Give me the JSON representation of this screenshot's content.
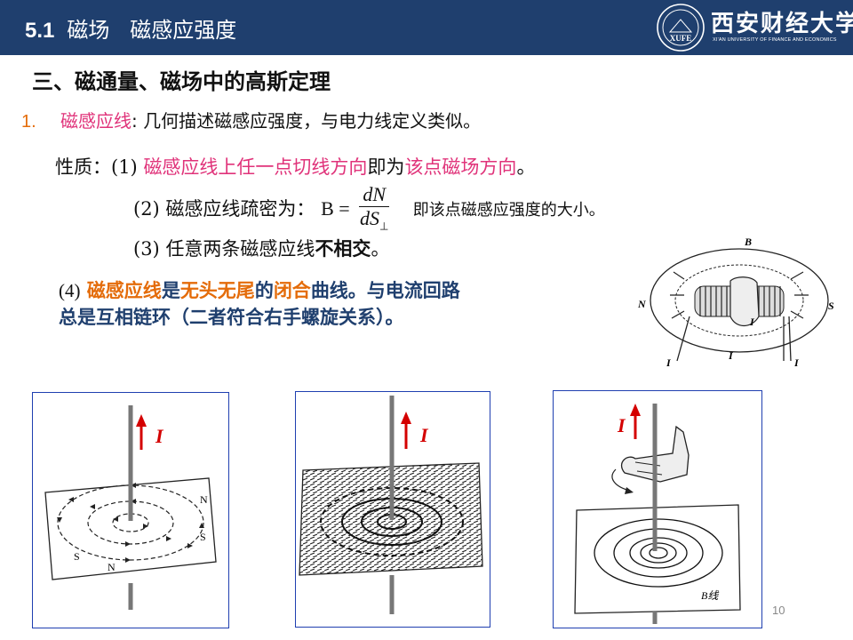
{
  "header": {
    "section_number": "5.1",
    "title": "磁场   磁感应强度",
    "logo": {
      "emblem_text": "XUFE",
      "name": "西安财经大学",
      "english": "XI'AN UNIVERSITY OF FINANCE AND ECONOMICS"
    },
    "colors": {
      "bar": "#1f3f6e",
      "text": "#ffffff"
    }
  },
  "heading": "三、磁通量、磁场中的高斯定理",
  "item1": {
    "number": "1.",
    "term": "磁感应线",
    "rest": ": 几何描述磁感应强度，与电力线定义类似。"
  },
  "properties": {
    "label": "性质：",
    "p1": {
      "num": "(1)",
      "text_a": "磁感应线上任一点切线方向",
      "text_b": "即为",
      "text_c": "该点磁场方向",
      "end": "。"
    },
    "p2": {
      "num": "(2)",
      "text": "磁感应线疏密为：",
      "lhs": "B =",
      "numerator": "dN",
      "denominator": "dS",
      "sub": "⊥",
      "tail": "即该点磁感应强度的大小。"
    },
    "p3": {
      "num": "(3)",
      "text": "任意两条磁感应线",
      "bold": "不相交",
      "end": "。"
    },
    "p4": {
      "num": "(4)",
      "term": "磁感应线",
      "t1": "是",
      "t2": "无头无尾",
      "t3": "的",
      "t4": "闭合",
      "t5": "曲线。与电流回路",
      "line2": "总是互相链环（二者符合右手螺旋关系）。"
    }
  },
  "figures": {
    "solenoid": {
      "labels": {
        "b": "B",
        "n": "N",
        "s": "S",
        "i": "I"
      }
    },
    "fig_a": {
      "current": "I",
      "pole_n": "N",
      "pole_s": "S"
    },
    "fig_b": {
      "current": "I"
    },
    "fig_c": {
      "current": "I",
      "field": "B线"
    }
  },
  "page_number": "10",
  "colors": {
    "accent_orange": "#e46c0a",
    "accent_pink": "#e0337a",
    "navy": "#1f3f6e",
    "frame_blue": "#1f3fb0",
    "arrow_red": "#d40000"
  }
}
